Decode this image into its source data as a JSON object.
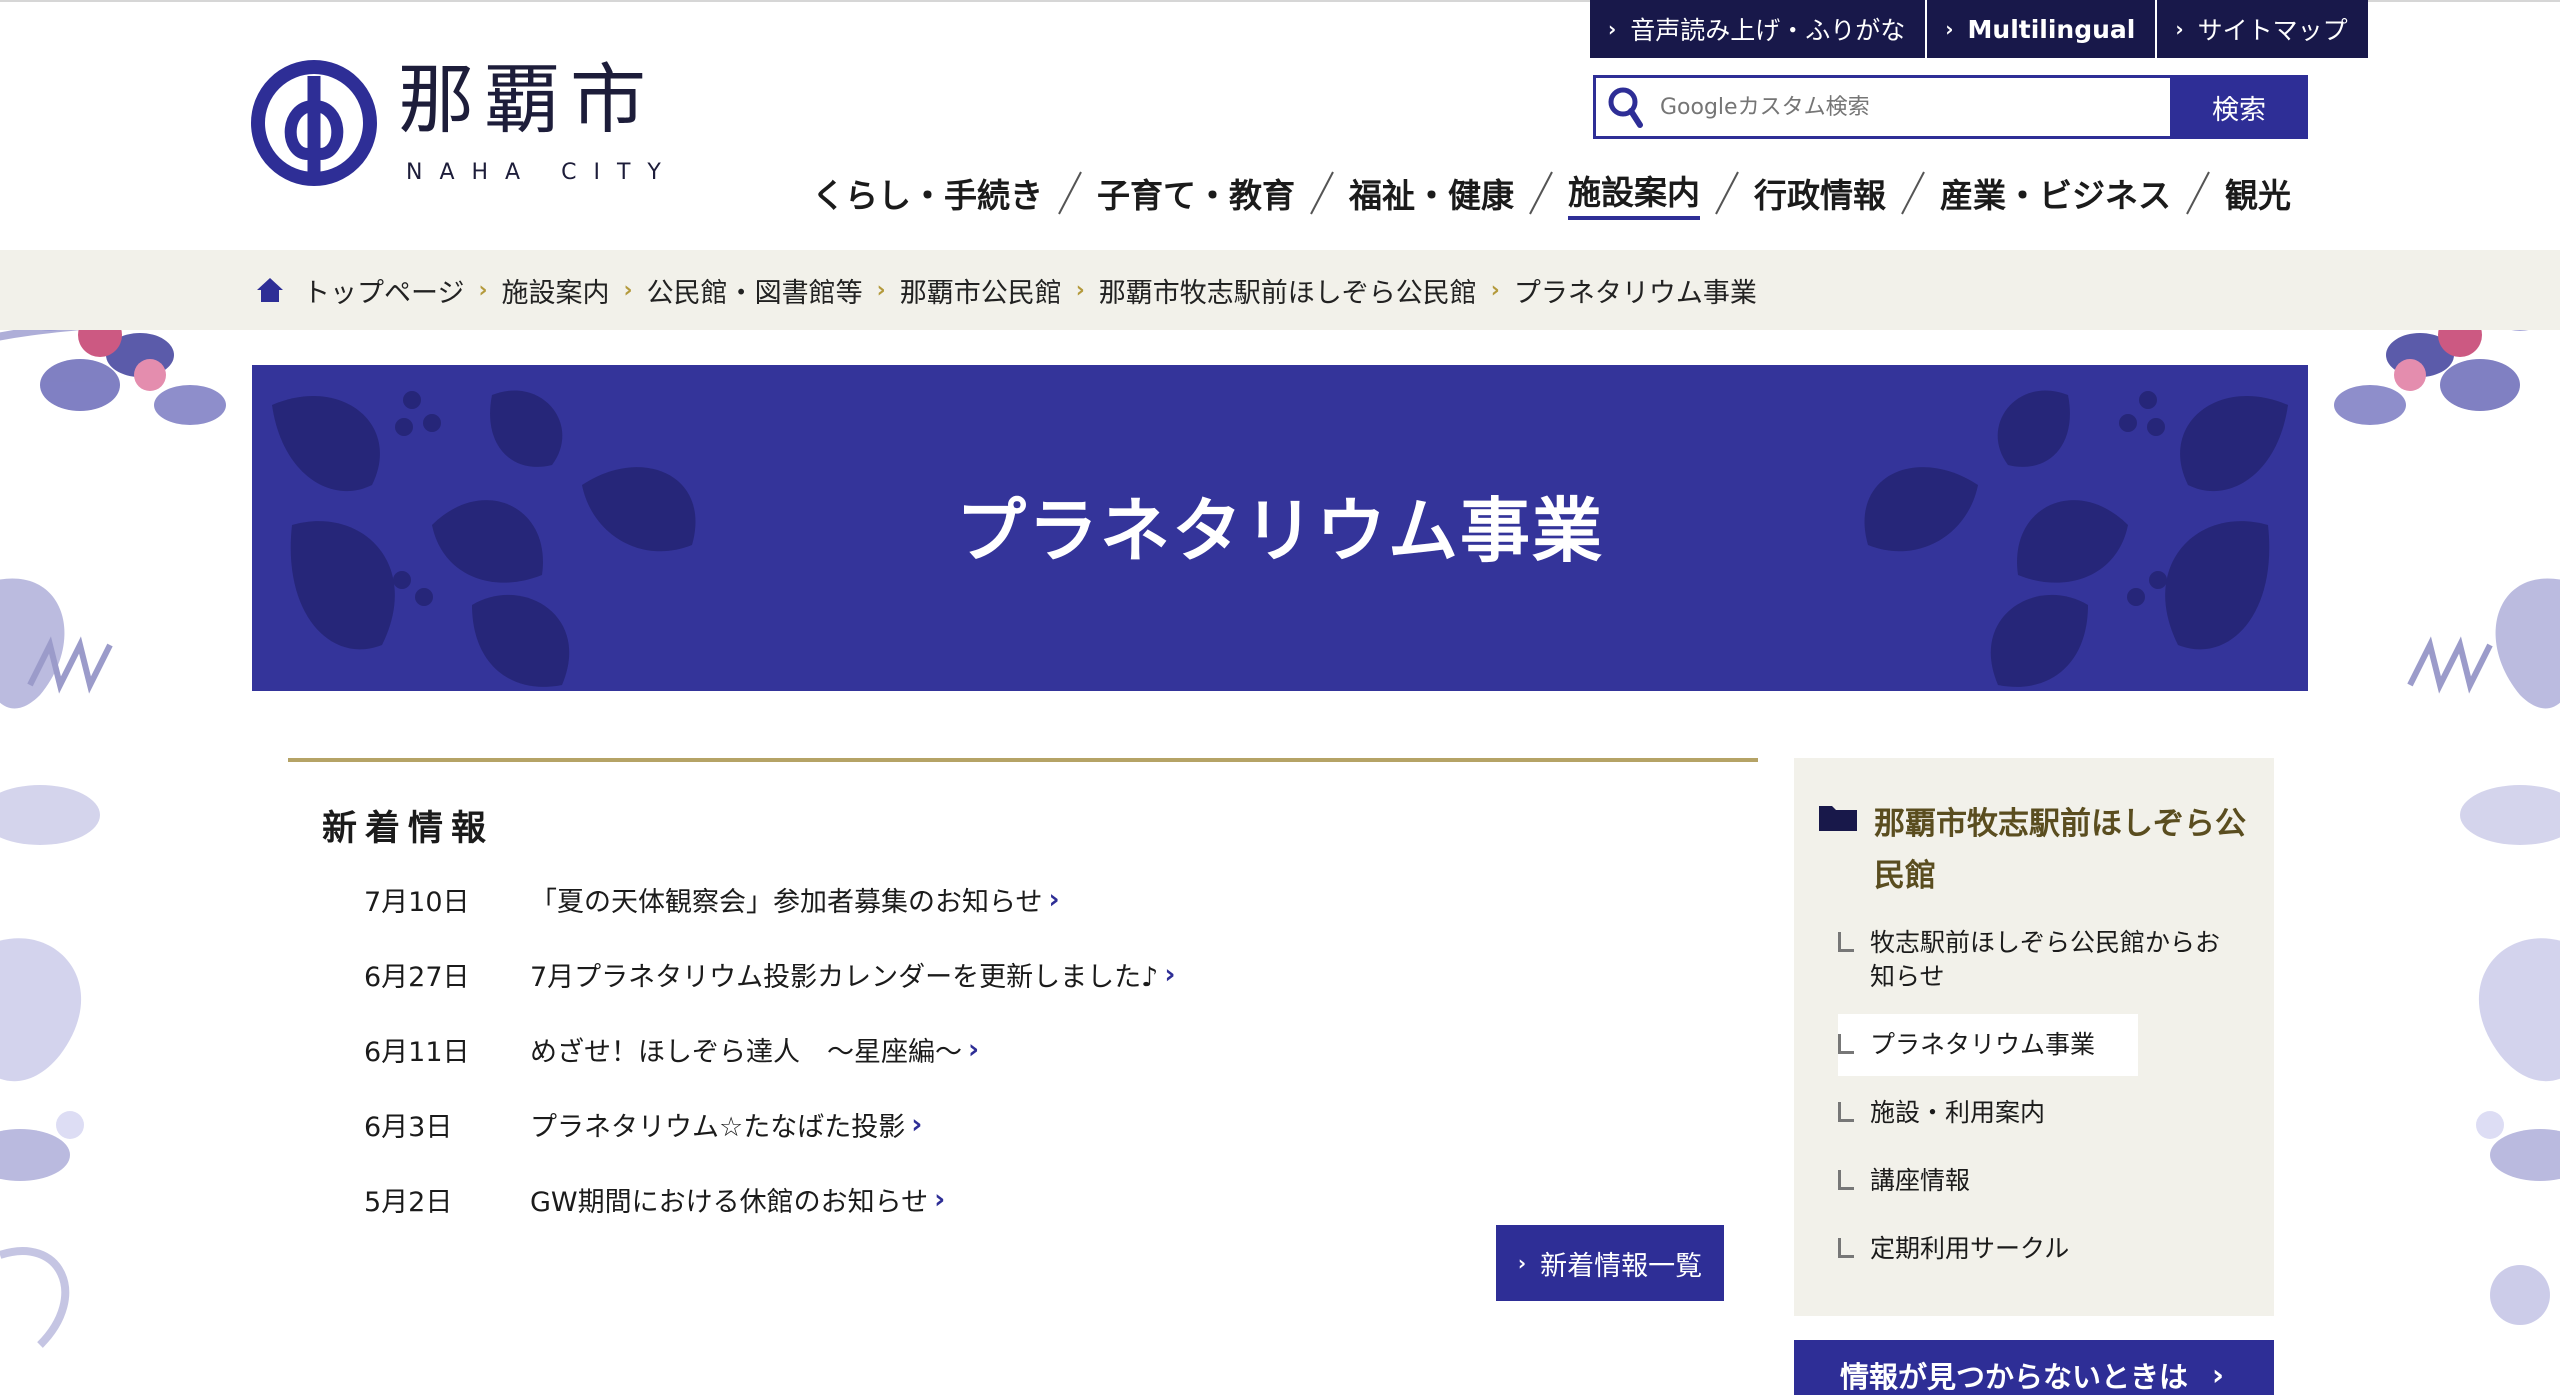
{
  "site": {
    "logo_kanji": "那覇市",
    "logo_en": "NAHA CITY"
  },
  "utility": {
    "items": [
      {
        "label": "音声読み上げ・ふりがな"
      },
      {
        "label": "Multilingual"
      },
      {
        "label": "サイトマップ"
      }
    ]
  },
  "search": {
    "placeholder": "Googleカスタム検索",
    "button": "検索"
  },
  "gnav": {
    "items": [
      {
        "label": "くらし・手続き"
      },
      {
        "label": "子育て・教育"
      },
      {
        "label": "福祉・健康"
      },
      {
        "label": "施設案内"
      },
      {
        "label": "行政情報"
      },
      {
        "label": "産業・ビジネス"
      },
      {
        "label": "観光"
      }
    ],
    "active": "施設案内"
  },
  "breadcrumb": {
    "items": [
      {
        "label": "トップページ"
      },
      {
        "label": "施設案内"
      },
      {
        "label": "公民館・図書館等"
      },
      {
        "label": "那覇市公民館"
      },
      {
        "label": "那覇市牧志駅前ほしぞら公民館"
      },
      {
        "label": "プラネタリウム事業"
      }
    ]
  },
  "banner": {
    "title": "プラネタリウム事業"
  },
  "news": {
    "title": "新着情報",
    "items": [
      {
        "date": "7月10日",
        "text": "「夏の天体観察会」参加者募集のお知らせ"
      },
      {
        "date": "6月27日",
        "text": "7月プラネタリウム投影カレンダーを更新しました♪"
      },
      {
        "date": "6月11日",
        "text": "めざせ！ほしぞら達人　〜星座編〜"
      },
      {
        "date": "6月3日",
        "text": "プラネタリウム☆たなばた投影"
      },
      {
        "date": "5月2日",
        "text": "GW期間における休館のお知らせ"
      }
    ],
    "more": "新着情報一覧"
  },
  "sidenav": {
    "title": "那覇市牧志駅前ほしぞら公民館",
    "items": [
      {
        "label": "牧志駅前ほしぞら公民館からお知らせ"
      },
      {
        "label": "プラネタリウム事業"
      },
      {
        "label": "施設・利用案内"
      },
      {
        "label": "講座情報"
      },
      {
        "label": "定期利用サークル"
      }
    ],
    "current": "プラネタリウム事業"
  },
  "notfound": {
    "label": "情報が見つからないときは"
  },
  "colors": {
    "primary": "#2e2e96",
    "navy": "#18184a",
    "gold": "#b5a366",
    "beige": "#f2f1ea"
  }
}
